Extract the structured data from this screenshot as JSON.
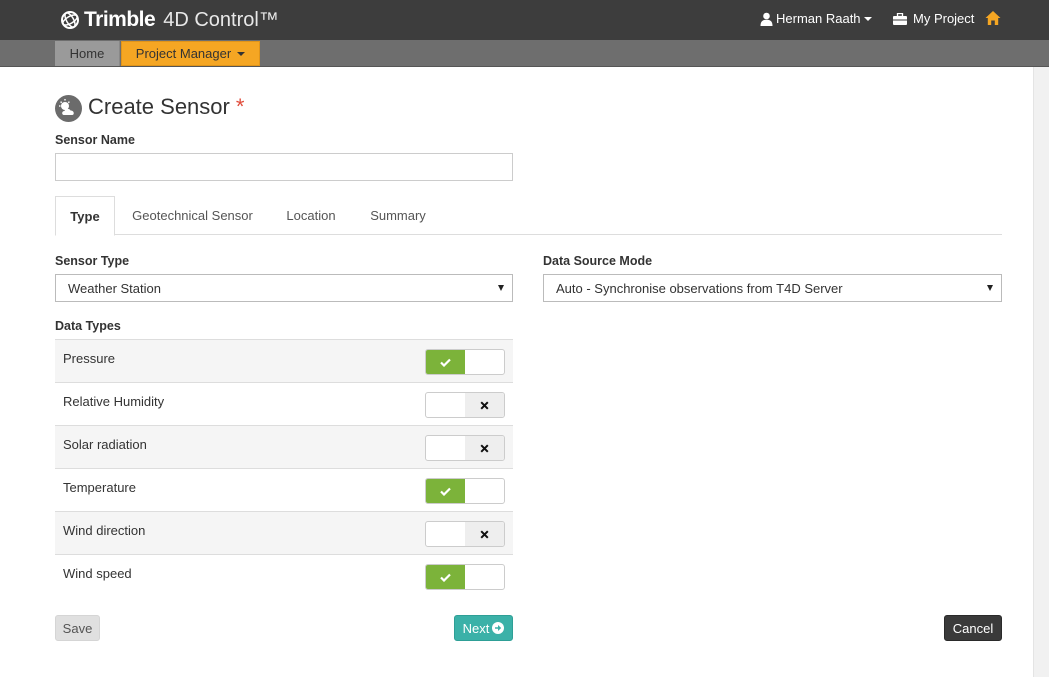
{
  "header": {
    "brand": "Trimble",
    "product": "4D Control™",
    "user_name": "Herman Raath",
    "project_label": "My Project"
  },
  "nav": {
    "home_label": "Home",
    "project_manager_label": "Project Manager"
  },
  "page": {
    "title": "Create Sensor",
    "required_marker": "*",
    "sensor_name_label": "Sensor Name",
    "sensor_name_value": "",
    "sensor_name_placeholder": ""
  },
  "tabs": [
    {
      "label": "Type",
      "active": true
    },
    {
      "label": "Geotechnical Sensor",
      "active": false
    },
    {
      "label": "Location",
      "active": false
    },
    {
      "label": "Summary",
      "active": false
    }
  ],
  "form": {
    "sensor_type_label": "Sensor Type",
    "sensor_type_value": "Weather Station",
    "data_source_label": "Data Source Mode",
    "data_source_value": "Auto - Synchronise observations from T4D Server",
    "data_types_label": "Data Types"
  },
  "data_types": [
    {
      "label": "Pressure",
      "enabled": true
    },
    {
      "label": "Relative Humidity",
      "enabled": false
    },
    {
      "label": "Solar radiation",
      "enabled": false
    },
    {
      "label": "Temperature",
      "enabled": true
    },
    {
      "label": "Wind direction",
      "enabled": false
    },
    {
      "label": "Wind speed",
      "enabled": true
    }
  ],
  "buttons": {
    "save": "Save",
    "next": "Next",
    "cancel": "Cancel"
  },
  "colors": {
    "topbar": "#3d3d3d",
    "nav_active": "#f5a623",
    "home_icon": "#f5a623",
    "toggle_on": "#7cb33a",
    "next_button": "#3bb1a8",
    "cancel_button": "#3a3a3a",
    "required": "#e04b3a"
  }
}
